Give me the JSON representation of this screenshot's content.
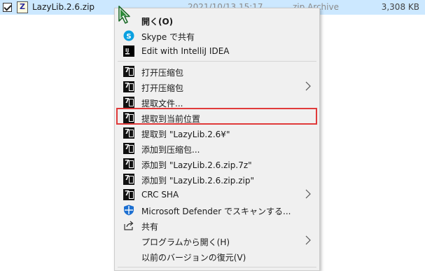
{
  "file": {
    "name": "LazyLib.2.6.zip",
    "date": "2021/10/13 15:17",
    "type": "zip Archive",
    "size": "3,308 KB"
  },
  "menu": {
    "open": "開く(O)",
    "skype": "Skype で共有",
    "intellij": "Edit with IntelliJ IDEA",
    "open_archive": "打开压缩包",
    "open_archive_sub": "打开压缩包",
    "extract_files": "提取文件...",
    "extract_here": "提取到当前位置",
    "extract_to": "提取到 \"LazyLib.2.6¥\"",
    "add_to_archive": "添加到压缩包...",
    "add_to_7z": "添加到 \"LazyLib.2.6.zip.7z\"",
    "add_to_zip": "添加到 \"LazyLib.2.6.zip.zip\"",
    "crc_sha": "CRC SHA",
    "defender": "Microsoft Defender でスキャンする...",
    "share": "共有",
    "open_with": "プログラムから開く(H)",
    "restore": "以前のバージョンの復元(V)"
  },
  "colors": {
    "selection": "#cce8ff",
    "highlight_border": "#e03a3a",
    "menu_bg": "#f0f0f0"
  }
}
